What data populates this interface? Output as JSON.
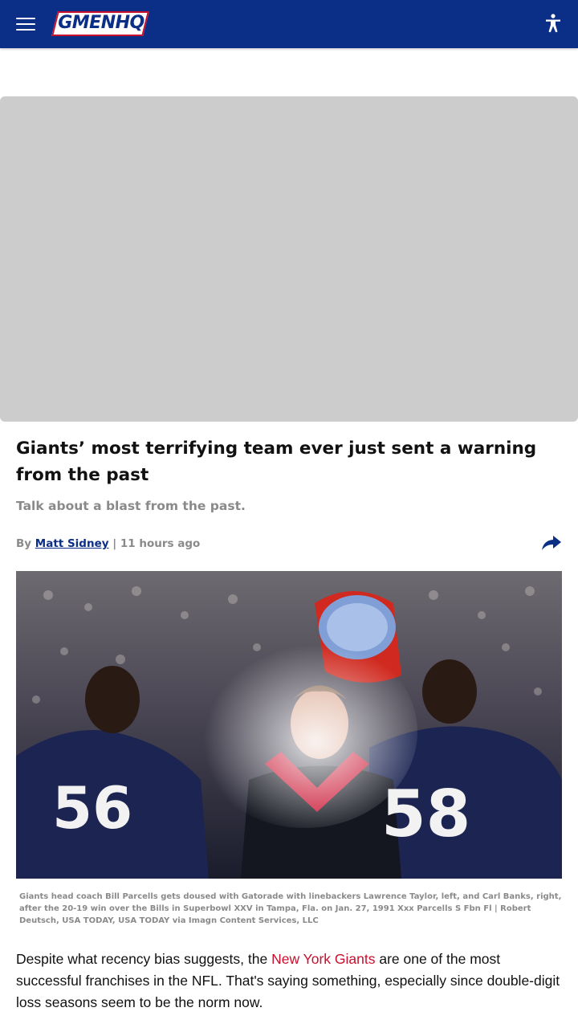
{
  "header": {
    "logo_text": "GMENHQ",
    "brand_color": "#0b2f86",
    "accent_color": "#c8102e",
    "menu_icon": "hamburger-menu-icon",
    "accessibility_icon": "accessibility-person-icon"
  },
  "article": {
    "headline": "Giants’ most terrifying team ever just sent a warning from the past",
    "subhead": "Talk about a blast from the past.",
    "byline": {
      "prefix": "By",
      "author": "Matt Sidney",
      "separator": "|",
      "time": "11 hours ago"
    },
    "share_icon": "share-arrow-icon",
    "photo": {
      "jersey_left": "56",
      "jersey_right": "58"
    },
    "caption": "Giants head coach Bill Parcells gets doused with Gatorade with linebackers Lawrence Taylor, left, and Carl Banks, right, after the 20-19 win over the Bills in Superbowl XXV in Tampa, Fla. on Jan. 27, 1991 Xxx Parcells S Fbn Fl | Robert Deutsch, USA TODAY, USA TODAY via Imagn Content Services, LLC",
    "body": {
      "before_link": "Despite what recency bias suggests, the ",
      "link": "New York Giants",
      "after_link": " are one of the most successful franchises in the NFL. That's saying something, especially since double-digit loss seasons seem to be the norm now."
    }
  }
}
